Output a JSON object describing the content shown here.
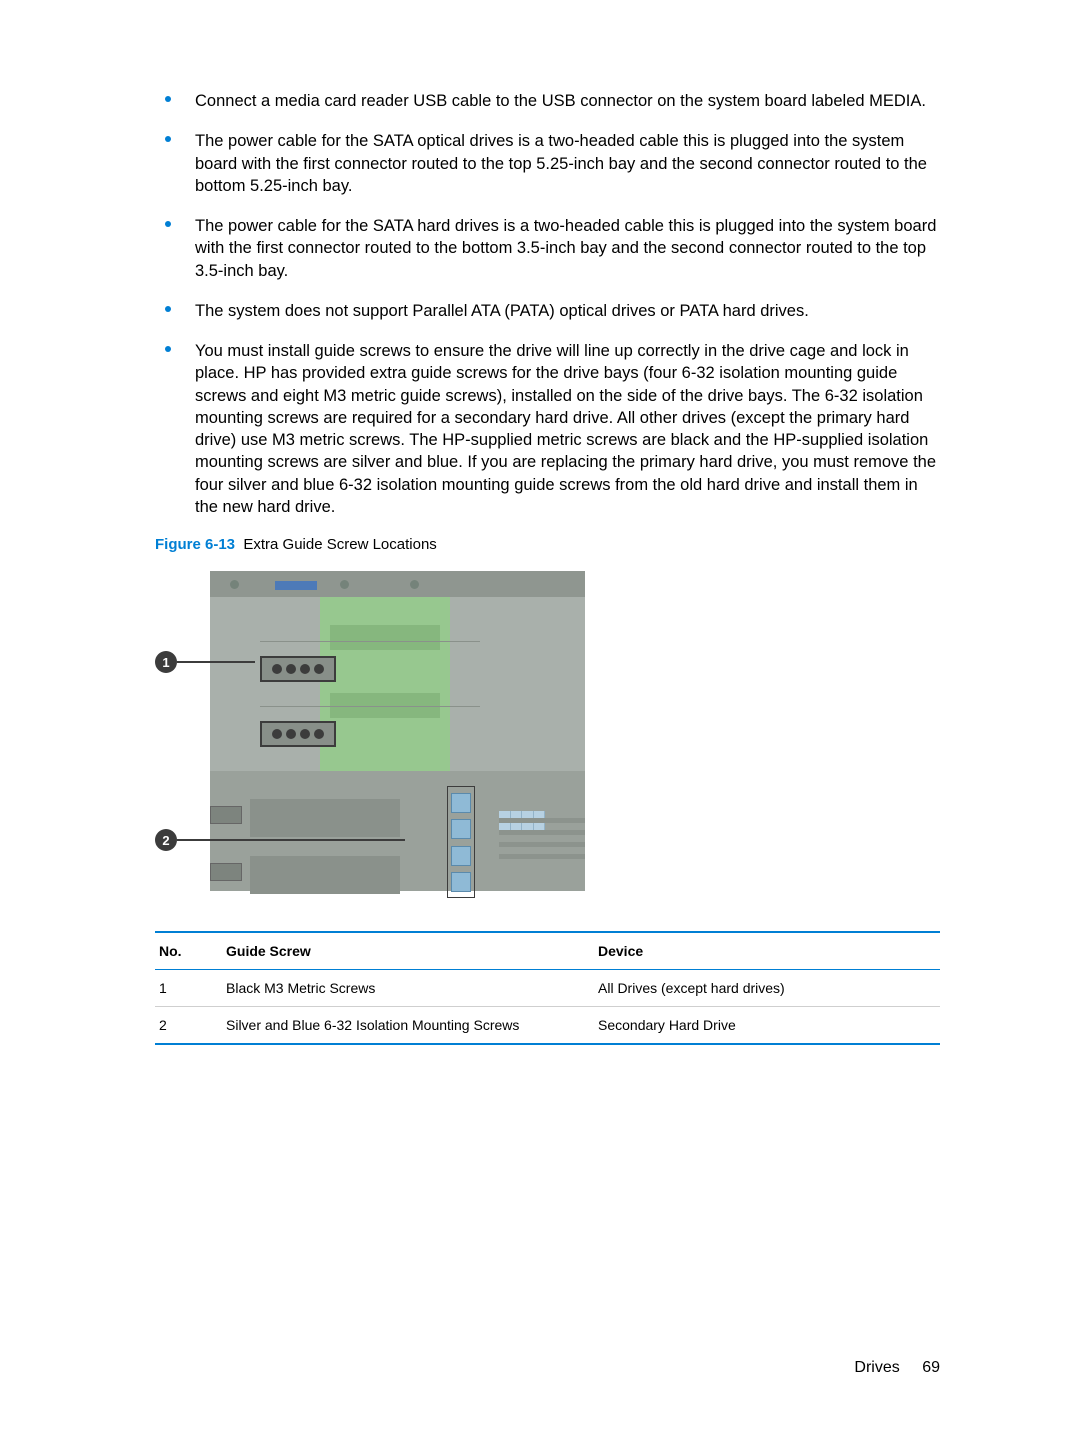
{
  "bullets": [
    "Connect a media card reader USB cable to the USB connector on the system board labeled MEDIA.",
    "The power cable for the SATA optical drives is a two-headed cable this is plugged into the system board with the first connector routed to the top 5.25-inch bay and the second connector routed to the bottom 5.25-inch bay.",
    "The power cable for the SATA hard drives is a two-headed cable this is plugged into the system board with the first connector routed to the bottom 3.5-inch bay and the second connector routed to the top 3.5-inch bay.",
    "The system does not support Parallel ATA (PATA) optical drives or PATA hard drives.",
    "You must install guide screws to ensure the drive will line up correctly in the drive cage and lock in place. HP has provided extra guide screws for the drive bays (four 6-32 isolation mounting guide screws and eight M3 metric guide screws), installed on the side of the drive bays. The 6-32 isolation mounting screws are required for a secondary hard drive. All other drives (except the primary hard drive) use M3 metric screws. The HP-supplied metric screws are black and the HP-supplied isolation mounting screws are silver and blue. If you are replacing the primary hard drive, you must remove the four silver and blue 6-32 isolation mounting guide screws from the old hard drive and install them in the new hard drive."
  ],
  "figure": {
    "label": "Figure 6-13",
    "caption": "Extra Guide Screw Locations",
    "callouts": [
      "1",
      "2"
    ]
  },
  "table": {
    "headers": [
      "No.",
      "Guide Screw",
      "Device"
    ],
    "rows": [
      [
        "1",
        "Black M3 Metric Screws",
        "All Drives (except hard drives)"
      ],
      [
        "2",
        "Silver and Blue 6-32 Isolation Mounting Screws",
        "Secondary Hard Drive"
      ]
    ]
  },
  "footer": {
    "section": "Drives",
    "page": "69"
  }
}
